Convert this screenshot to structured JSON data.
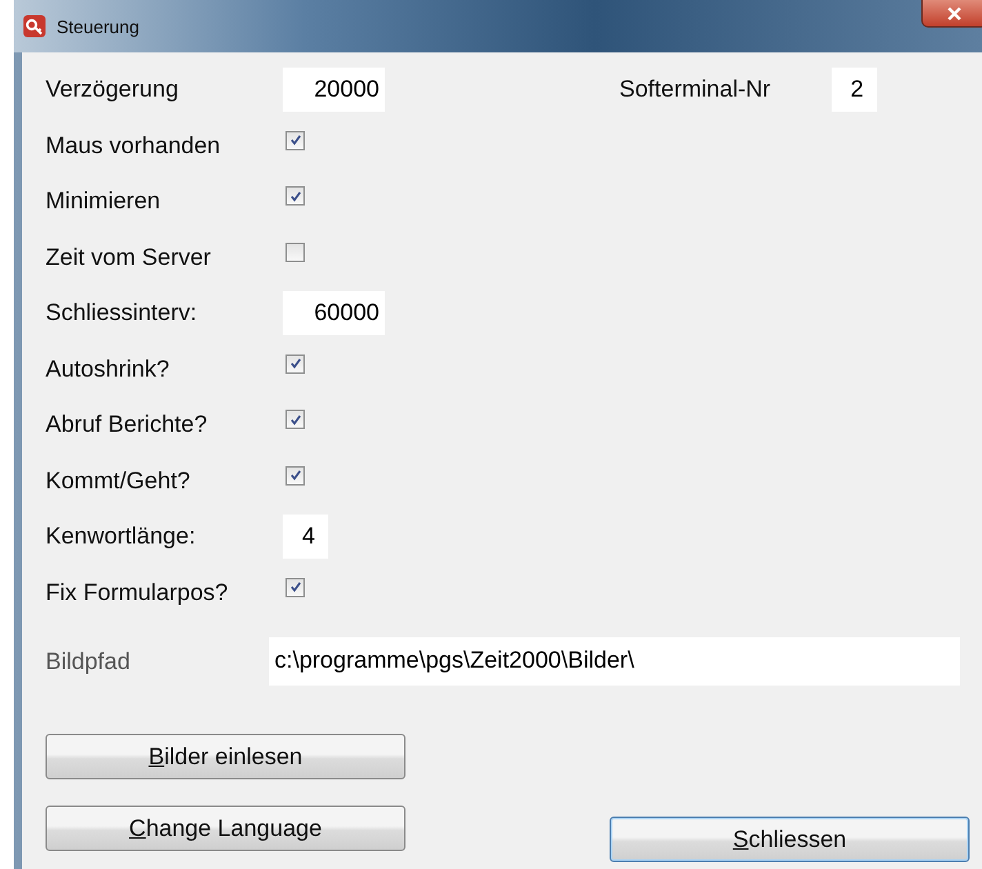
{
  "window": {
    "title": "Steuerung"
  },
  "rows": [
    {
      "kind": "field",
      "label": "Verzögerung",
      "value": "20000",
      "extra": {
        "label": "Softerminal-Nr",
        "value": "2"
      }
    },
    {
      "kind": "checkbox",
      "label": "Maus vorhanden",
      "checked": true
    },
    {
      "kind": "checkbox",
      "label": "Minimieren",
      "checked": true
    },
    {
      "kind": "checkbox",
      "label": "Zeit vom Server",
      "checked": false
    },
    {
      "kind": "field",
      "label": "Schliessinterv:",
      "value": "60000"
    },
    {
      "kind": "checkbox",
      "label": "Autoshrink?",
      "checked": true
    },
    {
      "kind": "checkbox",
      "label": "Abruf Berichte?",
      "checked": true
    },
    {
      "kind": "checkbox",
      "label": "Kommt/Geht?",
      "checked": true
    },
    {
      "kind": "field",
      "label": "Kenwortlänge:",
      "value": "4"
    },
    {
      "kind": "checkbox",
      "label": "Fix Formularpos?",
      "checked": true
    }
  ],
  "path": {
    "label": "Bildpfad",
    "value": "c:\\programme\\pgs\\Zeit2000\\Bilder\\"
  },
  "buttons": [
    "Bilder einlesen",
    "Change Language",
    "Schliessen"
  ]
}
